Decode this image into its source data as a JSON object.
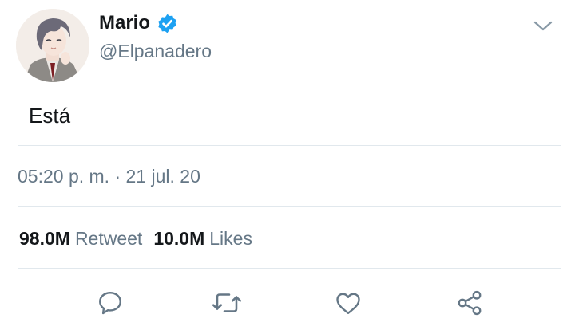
{
  "user": {
    "display_name": "Mario",
    "handle": "@Elpanadero",
    "verified": true
  },
  "tweet": {
    "text": "Está",
    "timestamp": "05:20 p. m. · 21 jul. 20"
  },
  "stats": {
    "retweets_count": "98.0M",
    "retweets_label": "Retweet",
    "likes_count": "10.0M",
    "likes_label": "Likes"
  },
  "actions": [
    "reply-icon",
    "retweet-icon",
    "like-icon",
    "share-icon"
  ],
  "colors": {
    "verified_blue": "#1da1f2",
    "text_primary": "#14171a",
    "text_secondary": "#657786",
    "divider": "#e1e8ed",
    "icon": "#657786"
  }
}
